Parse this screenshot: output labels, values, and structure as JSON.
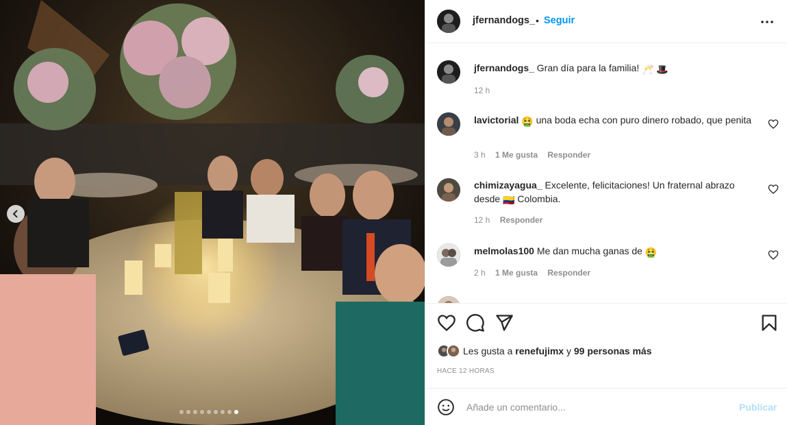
{
  "photo": {
    "carousel_dots": 9,
    "active_dot": 8
  },
  "header": {
    "username": "jfernandogs_",
    "separator": "•",
    "follow_label": "Seguir"
  },
  "caption": {
    "username": "jfernandogs_",
    "text": "Gran día para la familia!",
    "emojis": [
      "🥂",
      "🎩"
    ],
    "time": "12 h"
  },
  "comments": [
    {
      "username": "lavictorial",
      "emoji": "🤮",
      "text": "una boda echa con puro dinero robado, que penita",
      "time": "3 h",
      "likes": "1 Me gusta",
      "reply": "Responder"
    },
    {
      "username": "chimizayagua_",
      "text_before": "Excelente, felicitaciones! Un fraternal abrazo desde",
      "emoji": "🇨🇴",
      "text_after": "Colombia.",
      "time": "12 h",
      "reply": "Responder"
    },
    {
      "username": "melmolas100",
      "text": "Me dan mucha ganas de",
      "emoji": "🤮",
      "time": "2 h",
      "likes": "1 Me gusta",
      "reply": "Responder"
    }
  ],
  "likes": {
    "prefix": "Les gusta a",
    "user": "renefujimx",
    "conjunction": "y",
    "others": "99 personas más"
  },
  "time_ago": "HACE 12 HORAS",
  "comment_box": {
    "placeholder": "Añade un comentario...",
    "publish_label": "Publicar"
  },
  "icons": {
    "more": "more-options-icon",
    "heart": "heart-icon",
    "comment": "comment-icon",
    "share": "share-icon",
    "save": "bookmark-icon",
    "emoji": "emoji-icon"
  },
  "colors": {
    "link": "#0095f6",
    "publish_disabled": "#b2dffc",
    "muted": "#8e8e8e",
    "text": "#262626",
    "divider": "#efefef"
  }
}
